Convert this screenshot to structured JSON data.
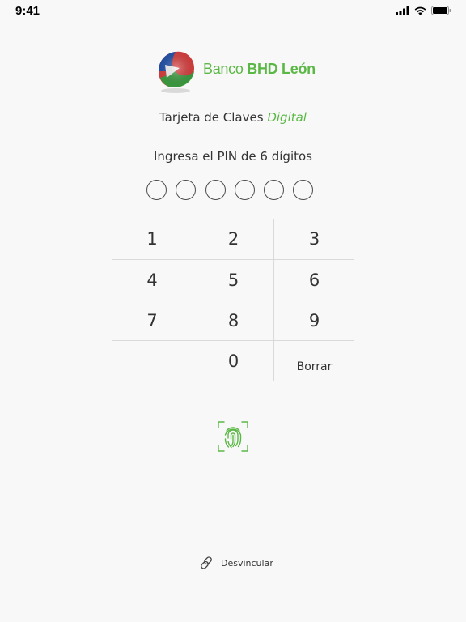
{
  "status_bar": {
    "time": "9:41"
  },
  "brand": {
    "name_prefix": "Banco ",
    "name_bold": "BHD León"
  },
  "app_title": {
    "text": "Tarjeta de Claves ",
    "accent": "Digital"
  },
  "pin_prompt": "Ingresa el PIN de 6 dígitos",
  "pin": {
    "length": 6,
    "filled": 0
  },
  "keypad": {
    "keys": [
      "1",
      "2",
      "3",
      "4",
      "5",
      "6",
      "7",
      "8",
      "9",
      "",
      "0",
      "Borrar"
    ]
  },
  "unlink": {
    "label": "Desvincular"
  },
  "colors": {
    "brand_green": "#5cb846",
    "text": "#333333",
    "divider": "#d9d9d9"
  }
}
